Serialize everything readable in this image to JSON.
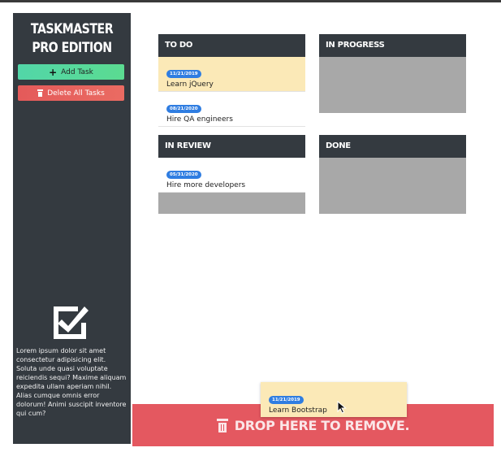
{
  "sidebar": {
    "brand": "TASKMASTER PRO EDITION",
    "add_task_label": "Add Task",
    "delete_all_label": "Delete All Tasks",
    "lorem": "Lorem ipsum dolor sit amet consectetur adipisicing elit. Soluta unde quasi voluptate reiciendis sequi? Maxime aliquam expedita ullam aperiam nihil. Alias cumque omnis error dolorum! Animi suscipit inventore qui cum?",
    "icon": "checkbox-icon"
  },
  "columns": {
    "todo": {
      "title": "TO DO",
      "tasks": [
        {
          "date": "11/21/2019",
          "text": "Learn jQuery",
          "highlighted": true
        },
        {
          "date": "08/21/2020",
          "text": "Hire QA engineers",
          "highlighted": false
        }
      ]
    },
    "in_progress": {
      "title": "IN PROGRESS",
      "tasks": []
    },
    "in_review": {
      "title": "IN REVIEW",
      "tasks": [
        {
          "date": "05/31/2020",
          "text": "Hire more developers",
          "highlighted": false
        }
      ]
    },
    "done": {
      "title": "DONE",
      "tasks": []
    }
  },
  "dragging": {
    "date": "11/21/2019",
    "text": "Learn Bootstrap"
  },
  "trash": {
    "label": "DROP HERE TO REMOVE.",
    "icon": "trash-icon"
  },
  "colors": {
    "sidebar_bg": "#343a40",
    "add_button": "#5bdb91",
    "delete_button": "#e45a5a",
    "highlight_card": "#fbe9b7",
    "badge": "#2f7de1",
    "trash_zone": "#e45860",
    "empty_lane": "#a8a8a8"
  }
}
